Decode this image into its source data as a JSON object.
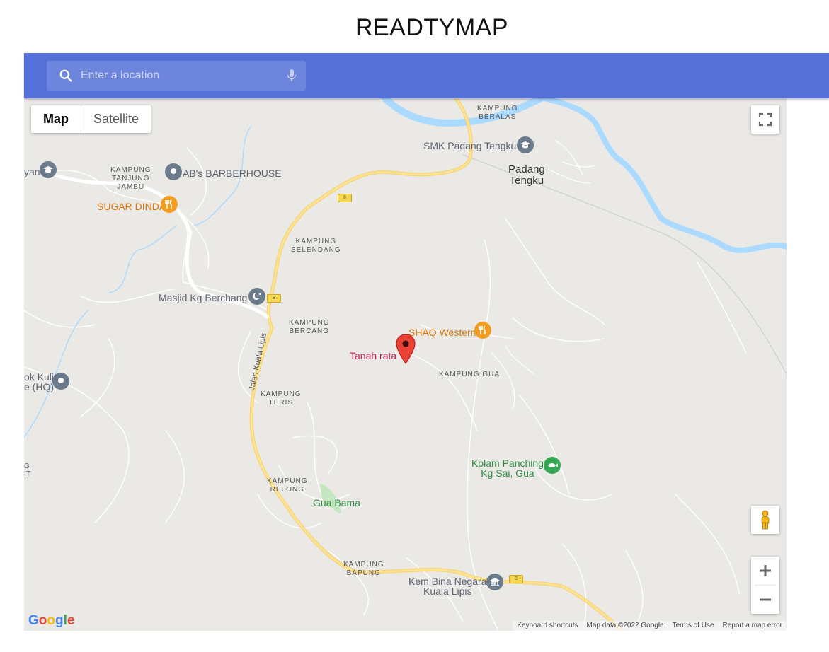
{
  "page": {
    "title": "READTYMAP"
  },
  "search": {
    "placeholder": "Enter a location",
    "value": ""
  },
  "map_type": {
    "options": [
      "Map",
      "Satellite"
    ],
    "selected": "Map"
  },
  "villages": {
    "beralas": [
      "KAMPUNG",
      "BERALAS"
    ],
    "tanjung_jambu": [
      "KAMPUNG",
      "TANJUNG",
      "JAMBU"
    ],
    "selendang": [
      "KAMPUNG",
      "SELENDANG"
    ],
    "bercang": [
      "KAMPUNG",
      "BERCANG"
    ],
    "teris": [
      "KAMPUNG",
      "TERIS"
    ],
    "relong": [
      "KAMPUNG",
      "RELONG"
    ],
    "bapung": [
      "KAMPUNG",
      "BAPUNG"
    ],
    "gua": "KAMPUNG GUA"
  },
  "towns": {
    "padang_tengku": [
      "Padang",
      "Tengku"
    ]
  },
  "pois": {
    "smk_padang_tengku": "SMK Padang Tengku",
    "barberhouse": "AB's BARBERHOUSE",
    "sugar_dinda": "SUGAR DINDA",
    "masjid": "Masjid Kg Berchang",
    "shaq_western": "SHAQ Western",
    "tanah_rata": "Tanah rata",
    "kolam_panching": [
      "Kolam Panching",
      "Kg Sai, Gua"
    ],
    "gua_bama": "Gua Bama",
    "kem_bina_negara": [
      "Kem Bina Negara",
      "Kuala Lipis"
    ],
    "left_edge_top": "yan",
    "left_edge_mid": [
      "ok Kulit",
      "e (HQ)"
    ],
    "left_edge_bottom": [
      "G",
      "IT"
    ]
  },
  "roads": {
    "route_number": "8",
    "jalan_kuala_lipis": "Jalan Kuala Lipis"
  },
  "logo": {
    "letters": [
      "G",
      "o",
      "o",
      "g",
      "l",
      "e"
    ],
    "colors": [
      "#4285F4",
      "#EA4335",
      "#FBBC05",
      "#4285F4",
      "#34A853",
      "#EA4335"
    ]
  },
  "attribution": {
    "keyboard_shortcuts": "Keyboard shortcuts",
    "map_data": "Map data ©2022 Google",
    "terms": "Terms of Use",
    "report": "Report a map error"
  },
  "colors": {
    "header": "#5570d7",
    "map_bg": "#ebe9e6",
    "river": "#aadaff",
    "road": "#fde293",
    "marker": "#ea4335"
  }
}
